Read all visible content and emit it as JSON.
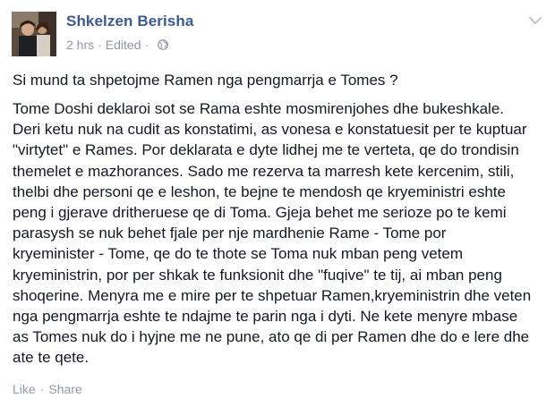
{
  "post": {
    "author": "Shkelzen Berisha",
    "time": "2 hrs",
    "separator": "·",
    "edited": "Edited",
    "privacy_icon": "globe-icon",
    "menu_icon": "chevron-down-icon",
    "title": "Si mund ta shpetojme Ramen nga pengmarrja e Tomes ?",
    "body_lines": [
      "Tome Doshi deklaroi sot se Rama eshte mosmirenjohes dhe bukeshkale.",
      "Deri ketu nuk na cudit as konstatimi, as vonesa e konstatuesit per te kuptuar",
      "\"virtytet\" e Rames. Por deklarata e dyte lidhej me te verteta, qe do trondisin",
      "themelet e mazhorances. Sado me rezerva ta marresh kete kercenim, stili,",
      "thelbi dhe personi qe e leshon, te bejne te mendosh qe kryeministri eshte",
      "peng i gjerave dritheruese qe di Toma. Gjeja behet me serioze po te kemi",
      "parasysh se nuk behet fjale per nje mardhenie Rame - Tome por",
      "kryeminister - Tome, qe do te thote se Toma nuk mban peng vetem",
      "kryeministrin, por per shkak te funksionit dhe \"fuqive\" te tij, ai mban peng",
      "shoqerine. Menyra me e mire per te shpetuar Ramen,kryeministrin dhe veten",
      "nga pengmarrja eshte te ndajme te parin nga i dyti. Ne kete menyre mbase",
      "as Tomes nuk do i hyjne me ne pune, ato qe di per Ramen dhe do e lere dhe",
      "ate te qete."
    ]
  },
  "actions": {
    "like": "Like",
    "separator": "·",
    "share": "Share"
  },
  "colors": {
    "link": "#3b5998",
    "meta": "#9197a3",
    "text": "#141823"
  }
}
